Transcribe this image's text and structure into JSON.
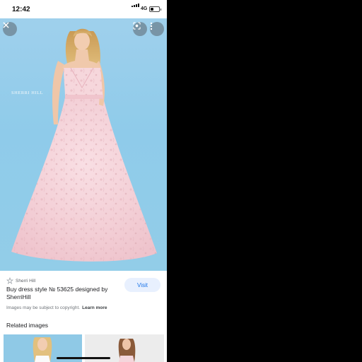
{
  "status_bar": {
    "time": "12:42",
    "network": "4G",
    "battery_level": 0.4
  },
  "image_viewer": {
    "brand_watermark": "SHERRI HILL",
    "close_icon": "close-icon",
    "lens_icon": "google-lens-icon",
    "more_icon": "more-vert-icon"
  },
  "result": {
    "source": "Sherri Hill",
    "title": "Buy dress style № 53625 designed by SherriHill",
    "visit_label": "Visit",
    "copyright_text": "Images may be subject to copyright.",
    "learn_more_label": "Learn more"
  },
  "related": {
    "heading": "Related images"
  },
  "colors": {
    "accent": "#1a73e8",
    "visit_bg": "#e8f0fe",
    "backdrop": "#92cde8"
  }
}
